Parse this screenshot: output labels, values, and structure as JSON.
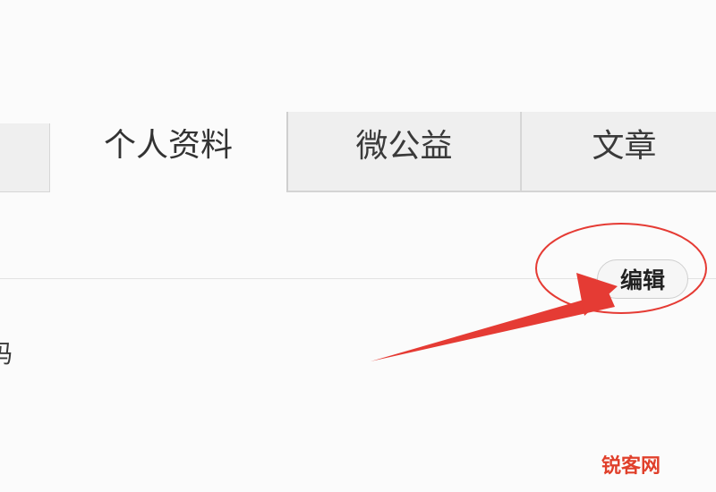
{
  "tabs": [
    {
      "label": "",
      "active": false
    },
    {
      "label": "个人资料",
      "active": true
    },
    {
      "label": "微公益",
      "active": false
    },
    {
      "label": "文章",
      "active": false
    }
  ],
  "profile": {
    "edit_label": "编辑",
    "truncated_field_label": "码"
  },
  "annotation": {
    "color": "#e53b34",
    "shapes": [
      "circle-highlight",
      "arrow-pointer"
    ]
  },
  "watermark": {
    "text": "锐客网",
    "color": "#e0402b"
  }
}
